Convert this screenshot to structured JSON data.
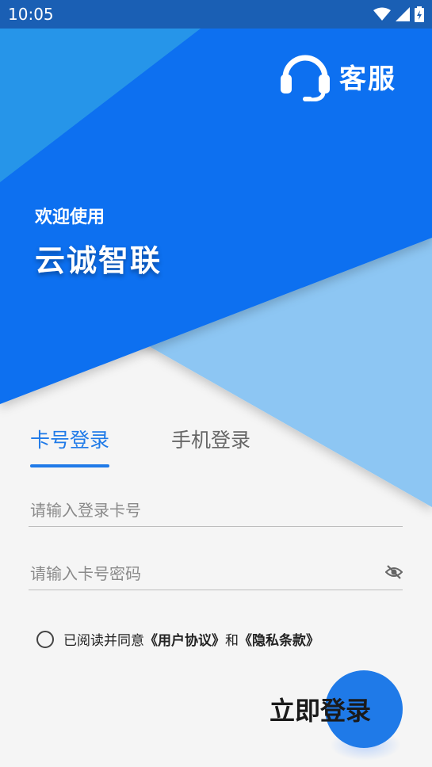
{
  "status_bar": {
    "time": "10:05"
  },
  "header": {
    "service_label": "客服"
  },
  "welcome": {
    "subtitle": "欢迎使用",
    "title": "云诚智联"
  },
  "tabs": [
    {
      "label": "卡号登录",
      "active": true
    },
    {
      "label": "手机登录",
      "active": false
    }
  ],
  "form": {
    "card_placeholder": "请输入登录卡号",
    "password_placeholder": "请输入卡号密码"
  },
  "agreement": {
    "prefix": "已阅读并同意",
    "user_agreement": "《用户协议》",
    "conjunction": "和",
    "privacy_policy": "《隐私条款》"
  },
  "login": {
    "label": "立即登录"
  },
  "colors": {
    "primary": "#1f7ae8",
    "hero_dark": "#0b6ff0",
    "hero_light": "#8dc6f3",
    "background": "#f5f5f5"
  },
  "icons": [
    "headset-icon",
    "wifi-icon",
    "signal-icon",
    "battery-icon",
    "eye-off-icon"
  ]
}
